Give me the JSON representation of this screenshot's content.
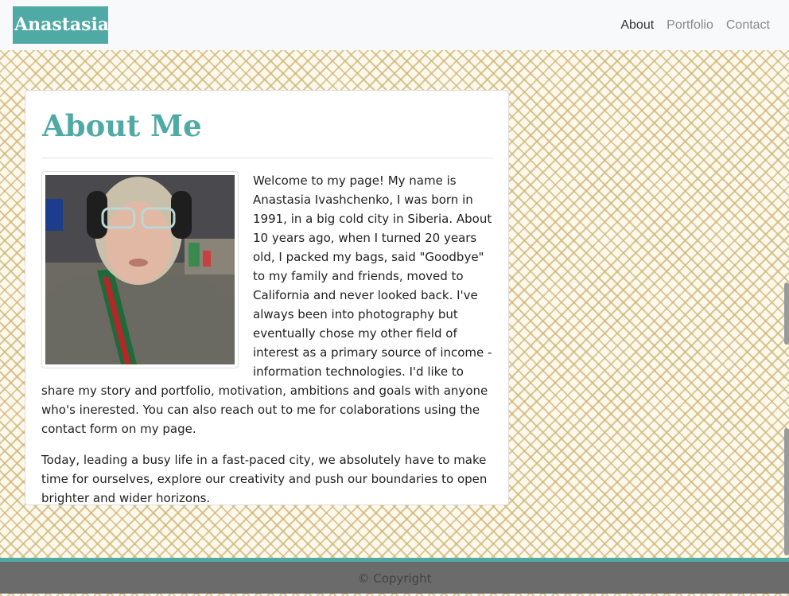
{
  "nav": {
    "brand": "Anastasia Ivashchenko",
    "links": [
      {
        "label": "About",
        "active": true
      },
      {
        "label": "Portfolio",
        "active": false
      },
      {
        "label": "Contact",
        "active": false
      }
    ]
  },
  "about": {
    "title": "About Me",
    "paragraph1": "Welcome to my page! My name is Anastasia Ivashchenko, I was born in 1991, in a big cold city in Siberia. About 10 years ago, when I turned 20 years old, I packed my bags, said \"Goodbye\" to my family and friends, moved to California and never looked back. I've always been into photography but eventually chose my other field of interest as a primary source of income - information technologies. I'd like to share my story and portfolio, motivation, ambitions and goals with anyone who's inerested. You can also reach out to me for colaborations using the contact form on my page.",
    "paragraph2": "Today, leading a busy life in a fast-paced city, we absolutely have to make time for ourselves, explore our creativity and push our boundaries to open brighter and wider horizons."
  },
  "footer": {
    "copyright": "© Copyright"
  },
  "colors": {
    "accent": "#4fa9a5",
    "footer_bg": "#6b6b6b",
    "pattern": "#cdb478"
  }
}
